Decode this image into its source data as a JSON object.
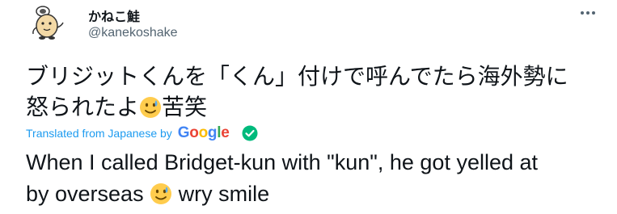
{
  "author": {
    "display_name": "かねこ鮭",
    "handle": "@kanekoshake"
  },
  "icons": {
    "avatar": "cartoon-character-avatar",
    "more": "more-dots-icon",
    "emoji": "sweat-smile-emoji",
    "verified": "checkmark-circle-icon"
  },
  "tweet": {
    "line1": "ブリジットくんを「くん」付けで呼んでたら海外勢に",
    "line2_before": "怒られたよ",
    "line2_after": "苦笑"
  },
  "translation": {
    "label": "Translated from Japanese by",
    "provider_letters": [
      "G",
      "o",
      "o",
      "g",
      "l",
      "e"
    ],
    "line1": "When I called Bridget-kun with \"kun\", he got yelled at",
    "line2_before": "by overseas",
    "line2_after": "wry smile"
  },
  "colors": {
    "link_blue": "#1d9bf0",
    "handle_gray": "#536471",
    "check_green": "#00ba7c"
  }
}
